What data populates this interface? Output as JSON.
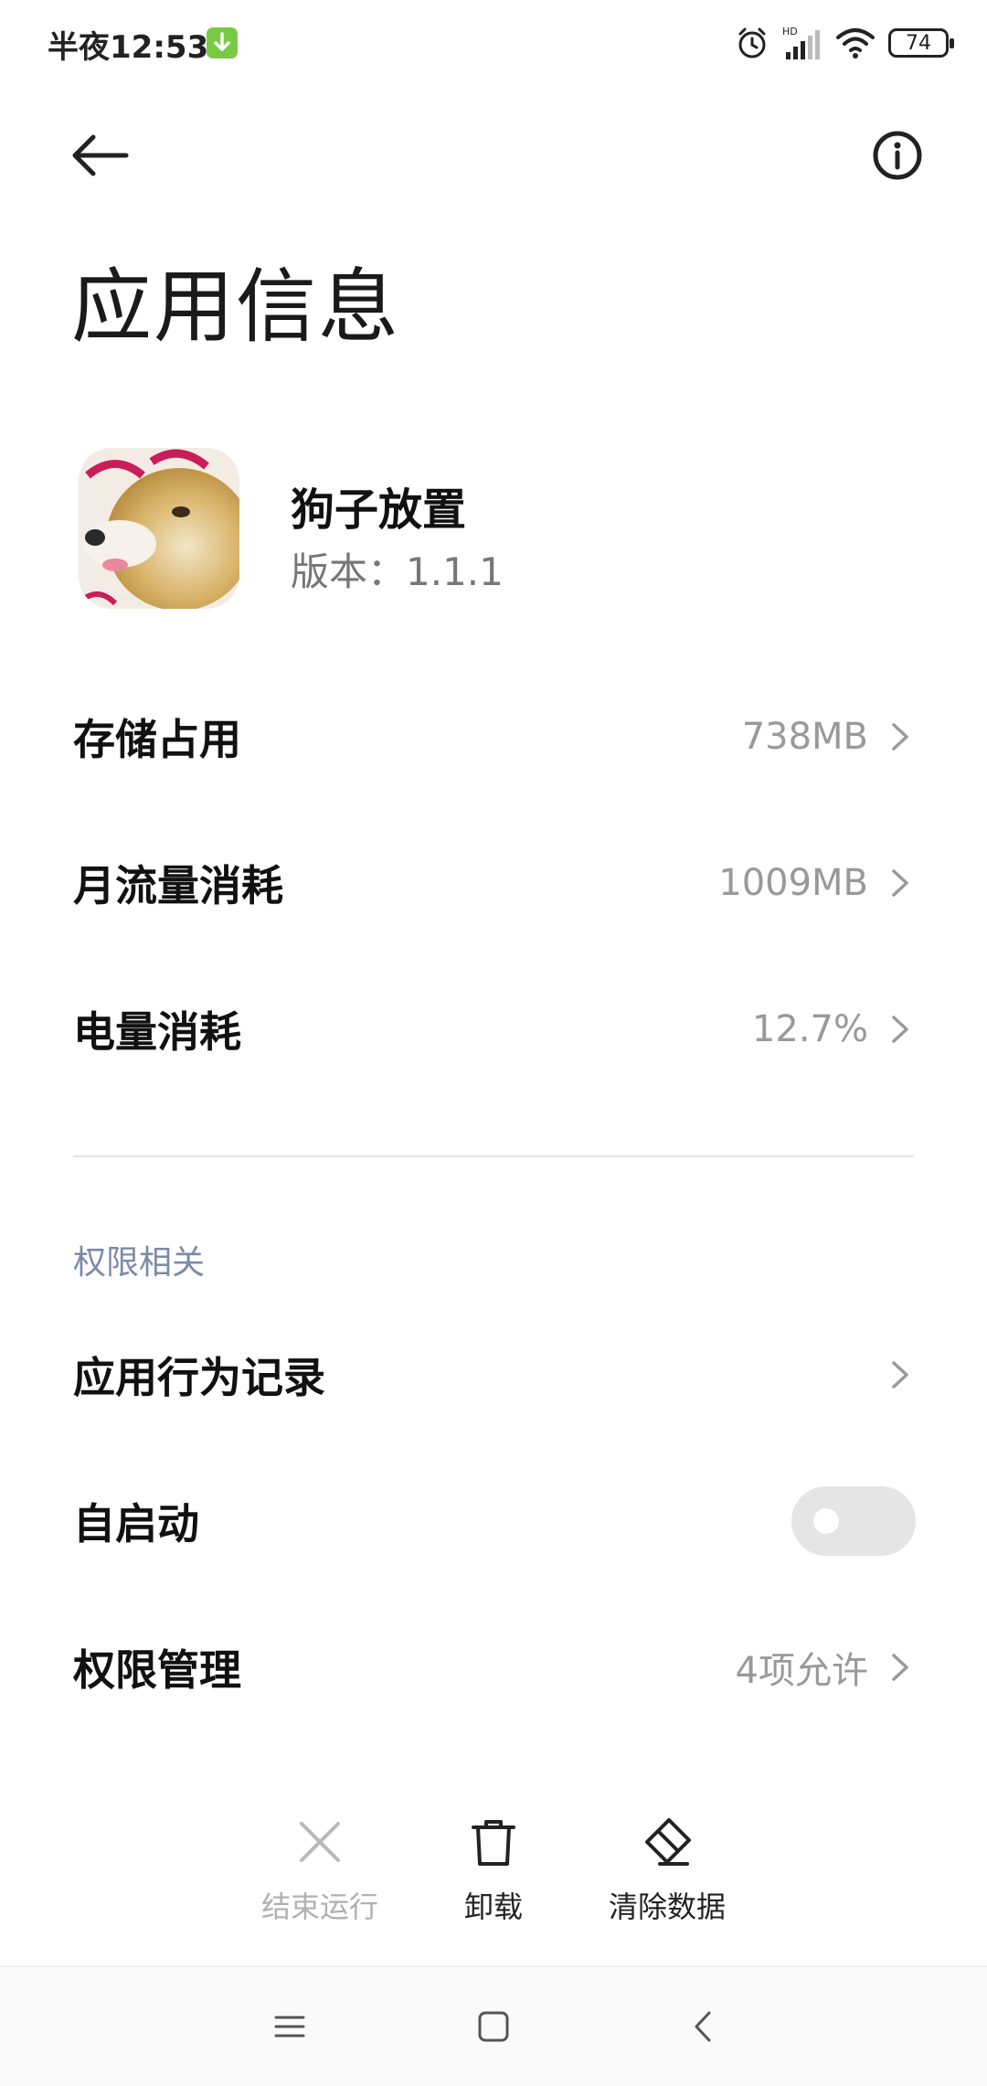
{
  "status_bar": {
    "time": "半夜12:53",
    "battery": "74"
  },
  "page_title": "应用信息",
  "app": {
    "name": "狗子放置",
    "version": "版本：1.1.1",
    "icon_text": "狗"
  },
  "rows": [
    {
      "label": "存储占用",
      "value": "738MB"
    },
    {
      "label": "月流量消耗",
      "value": "1009MB"
    },
    {
      "label": "电量消耗",
      "value": "12.7%"
    }
  ],
  "permissions_section": {
    "header": "权限相关",
    "behavior_log": {
      "label": "应用行为记录"
    },
    "autostart": {
      "label": "自启动",
      "enabled": false
    },
    "permission_manage": {
      "label": "权限管理",
      "value": "4项允许"
    }
  },
  "actions": [
    {
      "label": "结束运行",
      "icon": "close-icon",
      "enabled": false
    },
    {
      "label": "卸载",
      "icon": "trash-icon",
      "enabled": true
    },
    {
      "label": "清除数据",
      "icon": "eraser-icon",
      "enabled": true
    }
  ],
  "nav_bar": {
    "icons": [
      "menu-icon",
      "home-icon",
      "back-icon"
    ]
  },
  "colors": {
    "section_header": "#7d8aa8",
    "value_text": "#999999",
    "download_badge": "#7ac943",
    "toggle_off": "#e5e5e5"
  }
}
